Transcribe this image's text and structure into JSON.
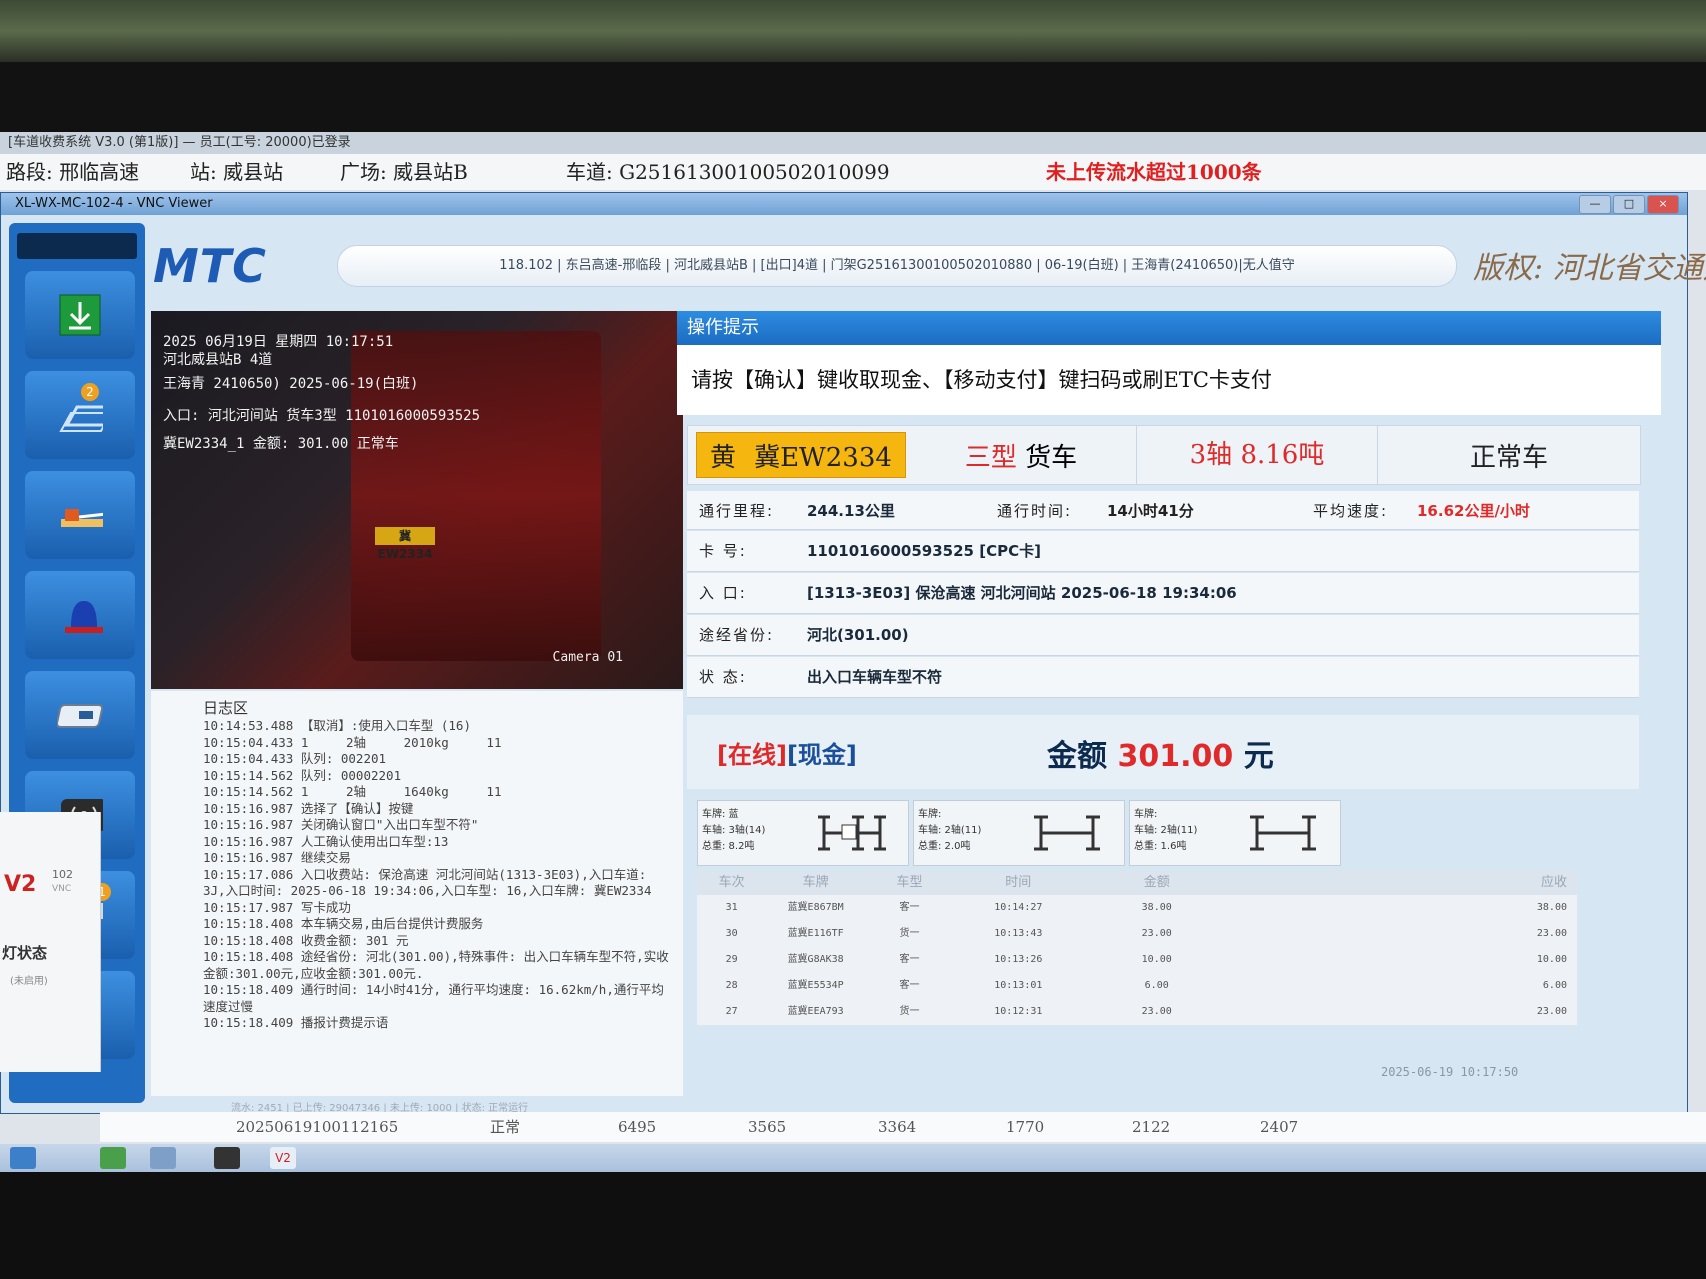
{
  "host": {
    "title": "[车道收费系统 V3.0 (第1版)] — 员工(工号: 20000)已登录",
    "section_label": "路段: 邢临高速",
    "station_label": "站: 威县站",
    "plaza_label": "广场: 威县站B",
    "lane_label": "车道: G25161300100502010099",
    "warning": "未上传流水超过1000条",
    "bottom_row": [
      "20250619100112165",
      "正常",
      "6495",
      "3565",
      "3364",
      "1770",
      "2122",
      "2407"
    ],
    "left_pane_label": "灯状态",
    "left_pane_sub": "(未启用)",
    "left_pane_code": "102",
    "left_pane_vnc": "VNC"
  },
  "vnc": {
    "title": "XL-WX-MC-102-4 - VNC Viewer",
    "btn_min": "—",
    "btn_max": "□",
    "btn_close": "×"
  },
  "app": {
    "brand": "MTC",
    "status_line": "118.102 | 东吕高速-邢临段 | 河北威县站B | [出口]4道 | 门架G25161300100502010880 | 06-19(白班) | 王海青(2410650)|无人值守",
    "copyright": "版权: 河北省交通运输厅"
  },
  "sidebar": {
    "badges": [
      "2",
      "1"
    ],
    "icons": [
      "download-icon",
      "layers-icon",
      "barrier-icon",
      "alarm-light-icon",
      "card-reader-icon",
      "broadcast-icon",
      "vehicle-queue-icon",
      "scanner-icon"
    ]
  },
  "camera": {
    "osd": [
      "2025  06月19日  星期四  10:17:51",
      "河北威县站B 4道",
      "王海青 2410650) 2025-06-19(白班)",
      "入口: 河北河间站  货车3型  1101016000593525",
      "冀EW2334_1  金额: 301.00  正常车"
    ],
    "plate_text": "冀EW2334",
    "label": "Camera 01"
  },
  "log": {
    "title": "日志区",
    "lines": [
      "10:14:53.488 【取消】:使用入口车型 (16)",
      "10:15:04.433 1     2轴     2010kg     11",
      "10:15:04.433 队列: 002201",
      "10:15:14.562 队列: 00002201",
      "10:15:14.562 1     2轴     1640kg     11",
      "10:15:16.987 选择了【确认】按键",
      "10:15:16.987 关闭确认窗口\"入出口车型不符\"",
      "10:15:16.987 人工确认使用出口车型:13",
      "10:15:16.987 继续交易",
      "10:15:17.086 入口收费站: 保沧高速 河北河间站(1313-3E03),入口车道: 3J,入口时间: 2025-06-18 19:34:06,入口车型: 16,入口车牌: 冀EW2334",
      "10:15:17.987 写卡成功",
      "10:15:18.408 本车辆交易,由后台提供计费服务",
      "10:15:18.408 收费金额: 301 元",
      "10:15:18.408 途经省份: 河北(301.00),特殊事件: 出入口车辆车型不符,实收金额:301.00元,应收金额:301.00元.",
      "10:15:18.409 通行时间: 14小时41分, 通行平均速度: 16.62km/h,通行平均速度过慢",
      "10:15:18.409 播报计费提示语"
    ],
    "footer": "流水: 2451 | 已上传: 29047346 | 未上传: 1000 | 状态: 正常运行"
  },
  "tip": {
    "header": "操作提示",
    "message": "请按【确认】键收取现金、【移动支付】键扫码或刷ETC卡支付"
  },
  "vehicle": {
    "plate_color": "黄",
    "plate": "冀EW2334",
    "type_class": "三型",
    "type_name": "货车",
    "axles": "3轴",
    "weight": "8.16吨",
    "status": "正常车"
  },
  "trip": {
    "mileage_label": "通行里程:",
    "mileage": "244.13公里",
    "time_label": "通行时间:",
    "time": "14小时41分",
    "speed_label": "平均速度:",
    "speed": "16.62公里/小时",
    "card_label": "卡  号:",
    "card": "1101016000593525 [CPC卡]",
    "entry_label": "入  口:",
    "entry": "[1313-3E03] 保沧高速 河北河间站 2025-06-18 19:34:06",
    "province_label": "途经省份:",
    "province": "河北(301.00)",
    "state_label": "状  态:",
    "state": "出入口车辆车型不符"
  },
  "payment": {
    "online": "[在线]",
    "mode": "[现金]",
    "amount_label": "金额",
    "amount": "301.00",
    "unit": "元"
  },
  "axle_cards": [
    {
      "plate": "车牌: 蓝",
      "axle": "车轴: 3轴(14)",
      "weight": "总重: 8.2吨"
    },
    {
      "plate": "车牌:",
      "axle": "车轴: 2轴(11)",
      "weight": "总重: 2.0吨"
    },
    {
      "plate": "车牌:",
      "axle": "车轴: 2轴(11)",
      "weight": "总重: 1.6吨"
    }
  ],
  "history": {
    "headers": [
      "车次",
      "车牌",
      "车型",
      "时间",
      "金额",
      "应收"
    ],
    "rows": [
      [
        "31",
        "蓝冀E867BM",
        "客一",
        "10:14:27",
        "38.00",
        "38.00"
      ],
      [
        "30",
        "蓝冀E116TF",
        "货一",
        "10:13:43",
        "23.00",
        "23.00"
      ],
      [
        "29",
        "蓝冀G8AK38",
        "客一",
        "10:13:26",
        "10.00",
        "10.00"
      ],
      [
        "28",
        "蓝冀E5534P",
        "客一",
        "10:13:01",
        "6.00",
        "6.00"
      ],
      [
        "27",
        "蓝冀EEA793",
        "货一",
        "10:12:31",
        "23.00",
        "23.00"
      ]
    ],
    "timestamp": "2025-06-19 10:17:50"
  },
  "colors": {
    "accent": "#1b6cc2",
    "warning": "#e02a2a",
    "plate_yellow": "#f5b70f"
  }
}
